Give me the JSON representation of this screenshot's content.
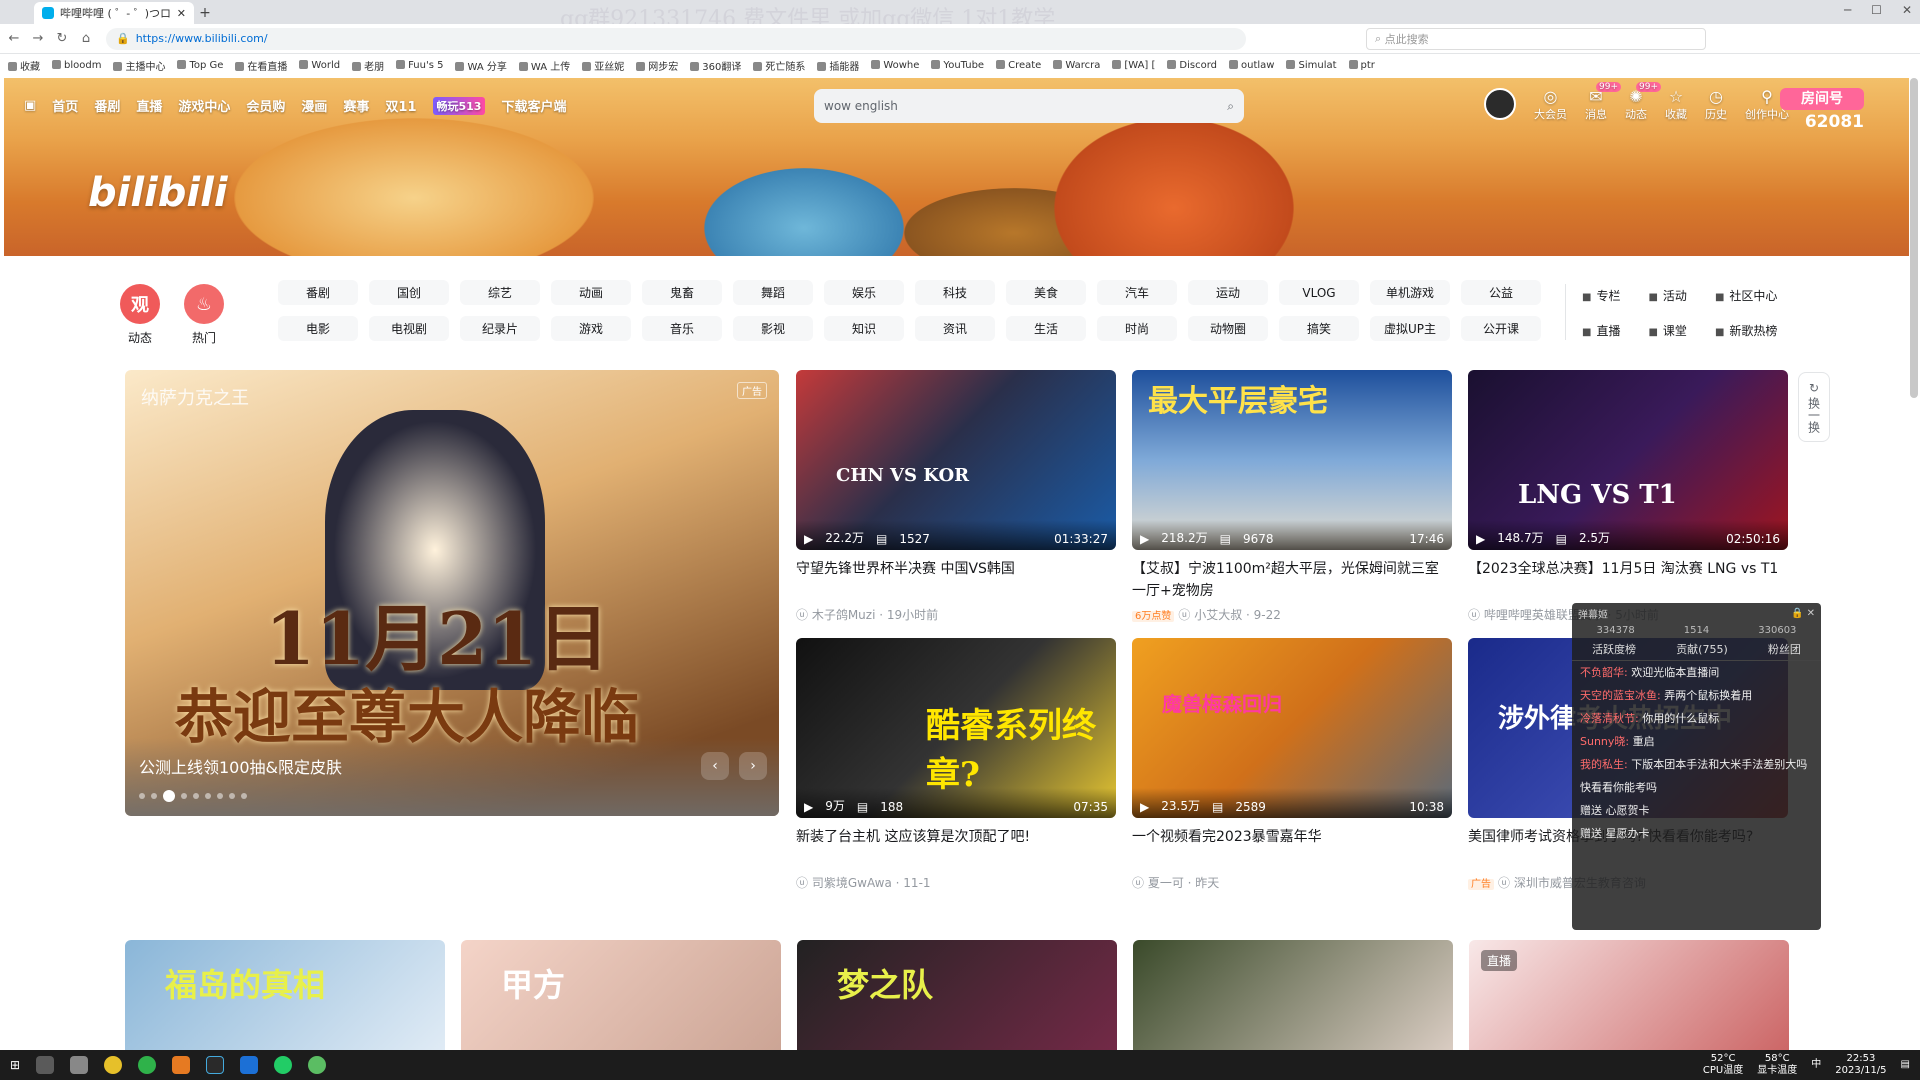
{
  "browser": {
    "tab_title": "哔哩哔哩 ( ゜- ゜)つロ 干杯~-b...",
    "url": "https://www.bilibili.com/",
    "search_placeholder": "点此搜索",
    "watermark": "qq群921331746 费文件里 或加qq微信 1对1教学",
    "bookmarks": [
      "收藏",
      "bloodm",
      "主播中心",
      "Top Ge",
      "在看直播",
      "World",
      "老朋",
      "Fuu's 5",
      "WA 分享",
      "WA 上传",
      "亚丝妮",
      "网步宏",
      "360翻译",
      "死亡随系",
      "插能器",
      "Wowhe",
      "YouTube",
      "Create",
      "Warcra",
      "[WA] [",
      "Discord",
      "outlaw",
      "Simulat",
      "ptr"
    ]
  },
  "header": {
    "nav": [
      "首页",
      "番剧",
      "直播",
      "游戏中心",
      "会员购",
      "漫画",
      "赛事",
      "双11"
    ],
    "nav_activity": "畅玩513",
    "nav_download": "下载客户端",
    "logo": "bilibili",
    "search_value": "wow english",
    "user_items": [
      {
        "label": "大会员",
        "icon": "vip-icon"
      },
      {
        "label": "消息",
        "icon": "message-icon",
        "badge": "99+"
      },
      {
        "label": "动态",
        "icon": "dynamic-icon",
        "badge": "99+"
      },
      {
        "label": "收藏",
        "icon": "favorite-icon"
      },
      {
        "label": "历史",
        "icon": "history-icon"
      },
      {
        "label": "创作中心",
        "icon": "creator-icon"
      }
    ],
    "brand_label": "房间号",
    "brand_number": "62081"
  },
  "side_nav": [
    {
      "label": "动态",
      "glyph": "观",
      "color": "#f05a5a"
    },
    {
      "label": "热门",
      "glyph": "♨",
      "color": "#f26a6a"
    }
  ],
  "categories": [
    "番剧",
    "国创",
    "综艺",
    "动画",
    "鬼畜",
    "舞蹈",
    "娱乐",
    "科技",
    "美食",
    "汽车",
    "运动",
    "VLOG",
    "单机游戏",
    "公益",
    "电影",
    "电视剧",
    "纪录片",
    "游戏",
    "音乐",
    "影视",
    "知识",
    "资讯",
    "生活",
    "时尚",
    "动物圈",
    "搞笑",
    "虚拟UP主",
    "公开课"
  ],
  "right_links": [
    "专栏",
    "活动",
    "社区中心",
    "直播",
    "课堂",
    "新歌热榜"
  ],
  "carousel": {
    "game_title": "纳萨力克之王",
    "ad": "广告",
    "date_text": "11月21日",
    "headline": "恭迎至尊大人降临",
    "caption": "公测上线领100抽&限定皮肤"
  },
  "refresh_label": "换一换",
  "videos": [
    {
      "views": "22.2万",
      "danmaku": "1527",
      "duration": "01:33:27",
      "title": "守望先锋世界杯半决赛 中国VS韩国",
      "author": "木子鸽Muzi",
      "time": "19小时前",
      "cap": "CHN  VS  KOR"
    },
    {
      "views": "218.2万",
      "danmaku": "9678",
      "duration": "17:46",
      "title": "【艾叔】宁波1100m²超大平层，光保姆间就三室一厅+宠物房",
      "author": "小艾大叔",
      "time": "9-22",
      "tag": "6万点赞",
      "cap": "最大平层豪宅"
    },
    {
      "views": "148.7万",
      "danmaku": "2.5万",
      "duration": "02:50:16",
      "title": "【2023全球总决赛】11月5日 淘汰赛 LNG vs T1",
      "author": "哔哩哔哩英雄联盟赛事",
      "time": "5小时前",
      "cap": "LNG  VS  T1"
    },
    {
      "views": "9万",
      "danmaku": "188",
      "duration": "07:35",
      "title": "新装了台主机 这应该算是次顶配了吧!",
      "author": "司紫境GwAwa",
      "time": "11-1",
      "cap": "酷睿系列终章?"
    },
    {
      "views": "23.5万",
      "danmaku": "2589",
      "duration": "10:38",
      "title": "一个视频看完2023暴雪嘉年华",
      "author": "夏一可",
      "time": "昨天",
      "cap": "魔兽梅森回归"
    },
    {
      "views": "",
      "danmaku": "",
      "duration": "",
      "title": "美国律师考试资格拿到了吗? 快看看你能考吗?",
      "author": "深圳市威普宏生教育咨询",
      "time": "",
      "tag": "广告",
      "cap": "涉外律考火热招生中"
    }
  ],
  "row3": [
    {
      "cap": "福岛的真相"
    },
    {
      "cap": "甲方"
    },
    {
      "cap": "梦之队"
    },
    {
      "cap": ""
    },
    {
      "cap": "",
      "live": "直播"
    }
  ],
  "chat": {
    "title": "弹幕姬",
    "stats": [
      "334378",
      "1514",
      "330603"
    ],
    "tabs": [
      "活跃度榜",
      "贡献(755)",
      "粉丝团"
    ],
    "messages": [
      {
        "name": "不负韶华:",
        "text": "欢迎光临本直播间"
      },
      {
        "name": "天空的蓝宝冰鱼:",
        "text": "弄两个鼠标换着用"
      },
      {
        "name": "冷落清秋节:",
        "text": "你用的什么鼠标"
      },
      {
        "name": "Sunny晓:",
        "text": "重启"
      },
      {
        "name": "我的私生:",
        "text": "下版本团本手法和大米手法差别大吗"
      },
      {
        "name": "",
        "text": "快看看你能考吗"
      },
      {
        "name": "",
        "text": "赠送 心愿贺卡"
      },
      {
        "name": "",
        "text": "赠送 星愿办卡"
      }
    ]
  },
  "taskbar": {
    "cpu": "52°C",
    "cpu_label": "CPU温度",
    "gpu": "58°C",
    "gpu_label": "显卡温度",
    "time": "22:53",
    "date": "2023/11/5",
    "ime": "中"
  }
}
